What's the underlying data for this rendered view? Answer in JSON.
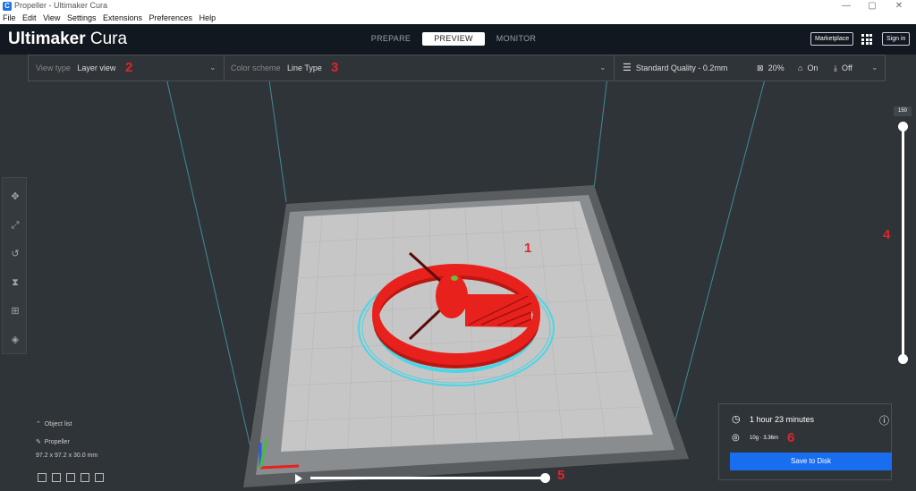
{
  "window": {
    "title": "Propeller - Ultimaker Cura",
    "app_icon": "cura-app-icon",
    "controls": {
      "minimize": "—",
      "maximize": "▢",
      "close": "✕"
    }
  },
  "menu": [
    "File",
    "Edit",
    "View",
    "Settings",
    "Extensions",
    "Preferences",
    "Help"
  ],
  "header": {
    "logo_main": "Ultimaker",
    "logo_sub": "Cura",
    "stages": [
      {
        "label": "PREPARE",
        "active": false
      },
      {
        "label": "PREVIEW",
        "active": true
      },
      {
        "label": "MONITOR",
        "active": false
      }
    ],
    "marketplace_label": "Marketplace",
    "signin_label": "Sign in"
  },
  "view_bar": {
    "view_type_label": "View type",
    "view_type_value": "Layer view",
    "color_scheme_label": "Color scheme",
    "color_scheme_value": "Line Type",
    "quality": "Standard Quality - 0.2mm",
    "infill": "20%",
    "support": "On",
    "adhesion": "Off"
  },
  "layer_slider": {
    "top_value": "150",
    "level": 1.0
  },
  "simulation": {
    "progress": 1.0
  },
  "object_list": {
    "toggle_label": "Object list",
    "object_name": "Propeller",
    "dimensions": "97.2 x 97.2 x 30.0 mm"
  },
  "print_info": {
    "time": "1 hour 23 minutes",
    "material": "10g · 3.36m",
    "save_label": "Save to Disk"
  },
  "annotations": [
    "1",
    "2",
    "3",
    "4",
    "5",
    "6"
  ],
  "colors": {
    "accent_blue": "#196ef0",
    "model_red": "#e8211d",
    "skirt_cyan": "#49d6e6",
    "annotation_red": "#e0242a",
    "build_plate": "#c6c6c6"
  }
}
